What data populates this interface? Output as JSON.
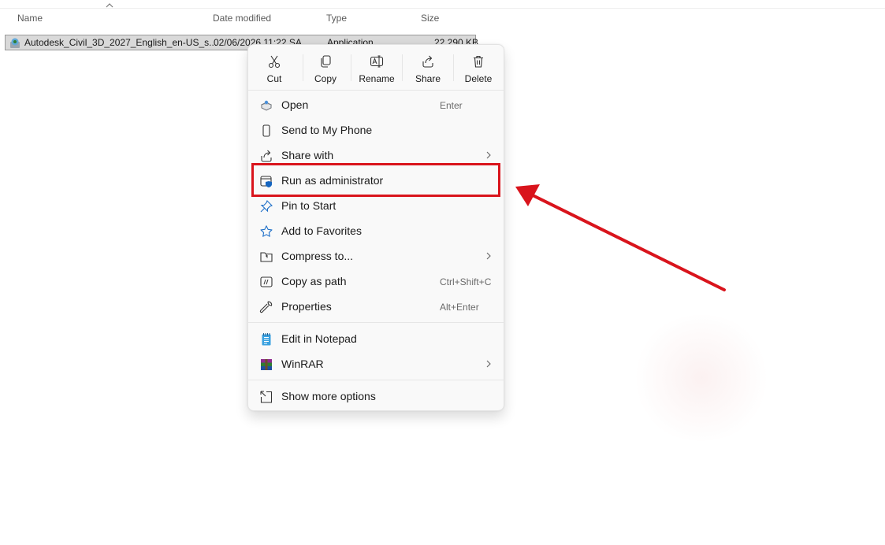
{
  "columns": {
    "name": "Name",
    "date_modified": "Date modified",
    "type": "Type",
    "size": "Size"
  },
  "file": {
    "name": "Autodesk_Civil_3D_2027_English_en-US_s...",
    "date_modified": "02/06/2026 11:22 SA",
    "type": "Application",
    "size": "22,290 KB",
    "icon": "installer-icon"
  },
  "context_menu": {
    "toolbar": [
      {
        "label": "Cut",
        "icon": "scissors-icon"
      },
      {
        "label": "Copy",
        "icon": "copy-icon"
      },
      {
        "label": "Rename",
        "icon": "rename-icon"
      },
      {
        "label": "Share",
        "icon": "share-icon"
      },
      {
        "label": "Delete",
        "icon": "trash-icon"
      }
    ],
    "items": [
      {
        "label": "Open",
        "shortcut": "Enter",
        "icon": "open-icon"
      },
      {
        "label": "Send to My Phone",
        "icon": "phone-icon"
      },
      {
        "label": "Share with",
        "icon": "share-with-icon",
        "submenu": true
      },
      {
        "label": "Run as administrator",
        "icon": "shield-icon"
      },
      {
        "label": "Pin to Start",
        "icon": "pin-icon"
      },
      {
        "label": "Add to Favorites",
        "icon": "star-icon"
      },
      {
        "label": "Compress to...",
        "icon": "zip-folder-icon",
        "submenu": true
      },
      {
        "label": "Copy as path",
        "shortcut": "Ctrl+Shift+C",
        "icon": "copy-path-icon"
      },
      {
        "label": "Properties",
        "shortcut": "Alt+Enter",
        "icon": "wrench-icon"
      },
      {
        "label": "Edit in Notepad",
        "icon": "notepad-icon"
      },
      {
        "label": "WinRAR",
        "icon": "winrar-icon",
        "submenu": true
      },
      {
        "label": "Show more options",
        "icon": "more-options-icon"
      }
    ]
  },
  "annotation": {
    "color": "#d9141c"
  }
}
